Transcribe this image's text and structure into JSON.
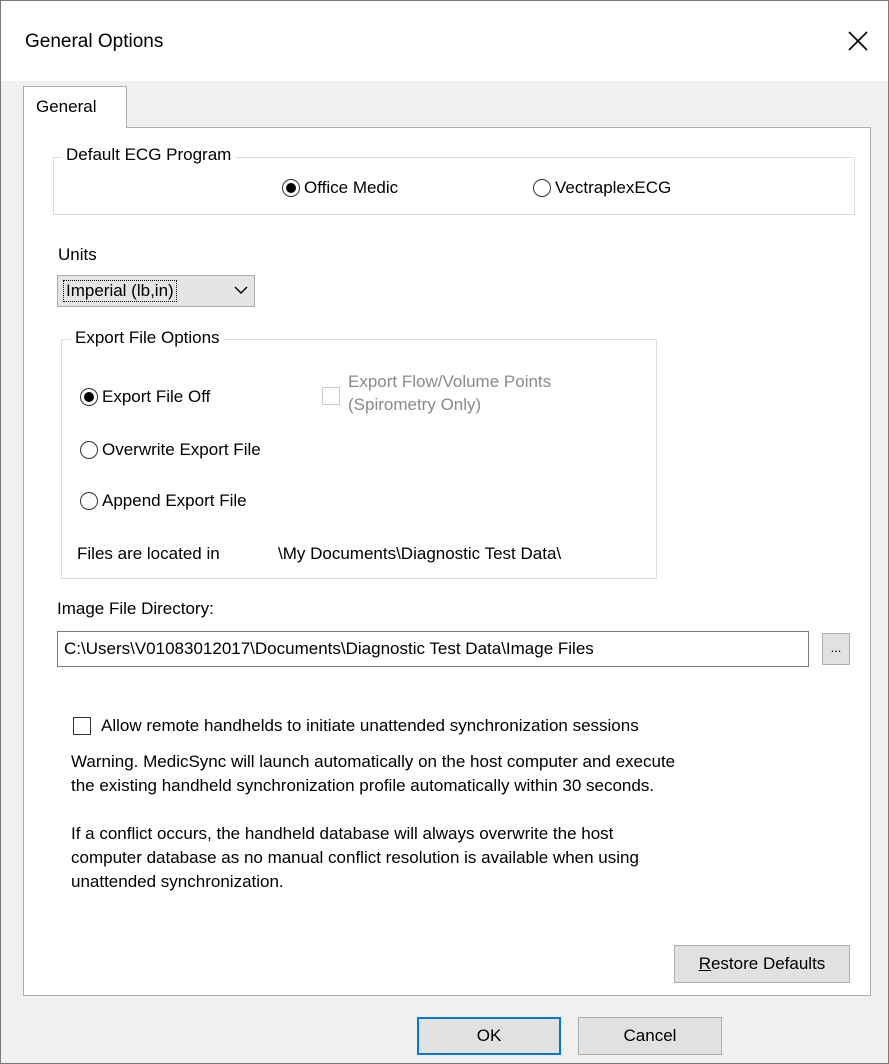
{
  "window": {
    "title": "General Options"
  },
  "tabs": [
    {
      "label": "General"
    }
  ],
  "default_ecg": {
    "legend": "Default ECG Program",
    "options": [
      {
        "label": "Office Medic",
        "checked": true
      },
      {
        "label": "VectraplexECG",
        "checked": false
      }
    ]
  },
  "units": {
    "label": "Units",
    "value": "Imperial (lb,in)"
  },
  "export": {
    "legend": "Export File Options",
    "options": [
      {
        "label": "Export File Off",
        "checked": true
      },
      {
        "label": "Overwrite Export File",
        "checked": false
      },
      {
        "label": "Append Export File",
        "checked": false
      }
    ],
    "flow_volume_line1": "Export Flow/Volume Points",
    "flow_volume_line2": "(Spirometry Only)",
    "location_label": "Files are located in",
    "location_path": "\\My Documents\\Diagnostic Test Data\\"
  },
  "image_dir": {
    "label": "Image File Directory:",
    "value": "C:\\Users\\V01083012017\\Documents\\Diagnostic Test Data\\Image Files",
    "browse_label": "..."
  },
  "remote": {
    "checkbox_label": "Allow remote handhelds to initiate unattended synchronization sessions",
    "warning_line1": "Warning.  MedicSync will launch automatically on the host computer and execute",
    "warning_line2": "the existing handheld synchronization profile automatically within 30 seconds.",
    "conflict_line1": "If a conflict occurs, the handheld database will always overwrite the host",
    "conflict_line2": "computer database as no manual conflict resolution is available when using",
    "conflict_line3": "unattended synchronization."
  },
  "buttons": {
    "restore_prefix": "R",
    "restore_rest": "estore Defaults",
    "ok": "OK",
    "cancel": "Cancel"
  },
  "icons": {
    "close": "close-icon",
    "dropdown": "chevron-down-icon"
  }
}
